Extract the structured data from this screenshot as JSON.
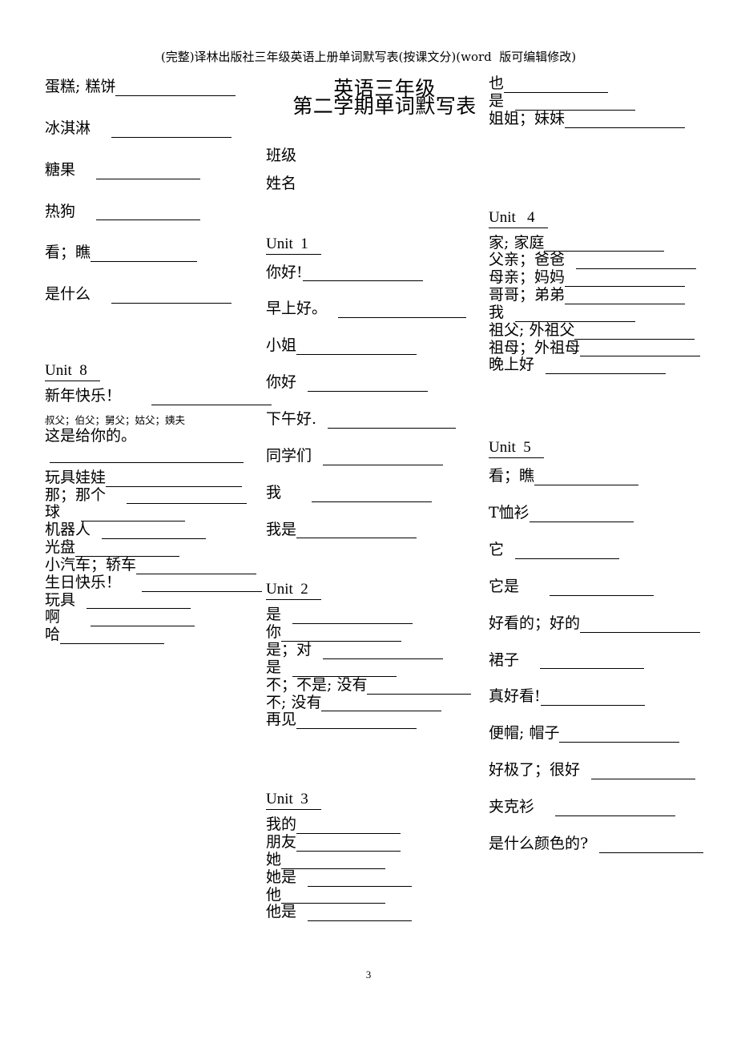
{
  "header": {
    "watermark_title": "(完整)译林出版社三年级英语上册单词默写表(按课文分)(word  版可编辑修改)"
  },
  "title": {
    "line1": "英语三年级",
    "line2": "第二学期单词默写表"
  },
  "fields": {
    "class_label": "班级",
    "name_label": "姓名"
  },
  "footer": {
    "page_number": "3"
  },
  "left_column": {
    "top_items": [
      {
        "label": "蛋糕; 糕饼"
      },
      {
        "label": "冰淇淋"
      },
      {
        "label": "糖果"
      },
      {
        "label": "热狗"
      },
      {
        "label": "看；瞧"
      },
      {
        "label": "是什么"
      }
    ],
    "unit8": {
      "heading": "Unit  8",
      "items": [
        {
          "label": "新年快乐！"
        },
        {
          "label": "叔父；伯父；舅父；姑父；姨夫",
          "note": "small"
        },
        {
          "label": "这是给你的。"
        },
        {
          "label": "玩具娃娃"
        },
        {
          "label": "那；那个"
        },
        {
          "label": "球"
        },
        {
          "label": "机器人"
        },
        {
          "label": "光盘"
        },
        {
          "label": "小汽车；轿车"
        },
        {
          "label": "生日快乐！"
        },
        {
          "label": "玩具"
        },
        {
          "label": "啊"
        },
        {
          "label": "哈"
        }
      ]
    }
  },
  "middle_column": {
    "unit1": {
      "heading": "Unit  1",
      "items": [
        {
          "label": "你好!"
        },
        {
          "label": "早上好。"
        },
        {
          "label": "小姐"
        },
        {
          "label": "你好"
        },
        {
          "label": "下午好."
        },
        {
          "label": "同学们"
        },
        {
          "label": "我"
        },
        {
          "label": "我是"
        }
      ]
    },
    "unit2": {
      "heading": "Unit  2",
      "items": [
        {
          "label": "是"
        },
        {
          "label": "你"
        },
        {
          "label": "是；对"
        },
        {
          "label": "是"
        },
        {
          "label": "不；不是; 没有"
        },
        {
          "label": "不; 没有"
        },
        {
          "label": "再见"
        }
      ]
    },
    "unit3": {
      "heading": "Unit  3",
      "items": [
        {
          "label": "我的"
        },
        {
          "label": "朋友"
        },
        {
          "label": "她"
        },
        {
          "label": "她是"
        },
        {
          "label": "他"
        },
        {
          "label": "他是"
        }
      ]
    }
  },
  "right_column": {
    "top_items": [
      {
        "label": "也"
      },
      {
        "label": "是"
      },
      {
        "label": "姐姐；妹妹"
      }
    ],
    "unit4": {
      "heading": "Unit   4",
      "items": [
        {
          "label": "家; 家庭"
        },
        {
          "label": "父亲；爸爸"
        },
        {
          "label": "母亲；妈妈"
        },
        {
          "label": "哥哥；弟弟"
        },
        {
          "label": "我"
        },
        {
          "label": "祖父; 外祖父"
        },
        {
          "label": "祖母；外祖母"
        },
        {
          "label": "晚上好"
        }
      ]
    },
    "unit5": {
      "heading": "Unit  5",
      "items": [
        {
          "label": "看；瞧"
        },
        {
          "label": "T恤衫"
        },
        {
          "label": "它"
        },
        {
          "label": "它是"
        },
        {
          "label": "好看的；好的"
        },
        {
          "label": "裙子"
        },
        {
          "label": "真好看!"
        },
        {
          "label": "便帽; 帽子"
        },
        {
          "label": "好极了；很好"
        },
        {
          "label": "夹克衫"
        },
        {
          "label": "是什么颜色的?"
        }
      ]
    }
  }
}
